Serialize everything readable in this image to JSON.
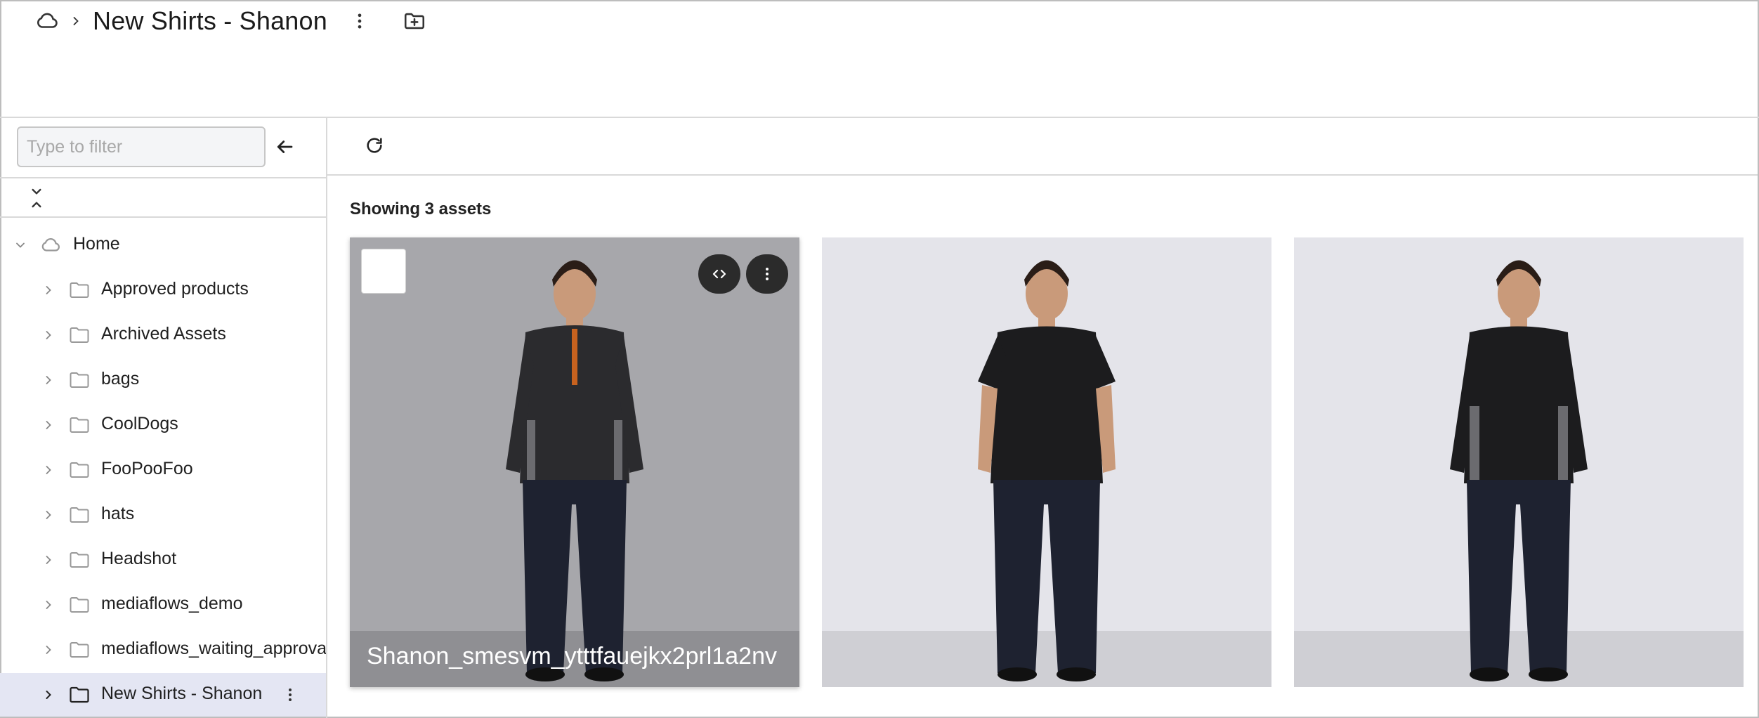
{
  "breadcrumb": {
    "root_icon": "cloud-icon",
    "separator_icon": "chevron-right-icon",
    "title": "New Shirts - Shanon"
  },
  "sidebar": {
    "filter": {
      "placeholder": "Type to filter",
      "value": ""
    },
    "home_label": "Home",
    "items": [
      {
        "label": "Approved products"
      },
      {
        "label": "Archived Assets"
      },
      {
        "label": "bags"
      },
      {
        "label": "CoolDogs"
      },
      {
        "label": "FooPooFoo"
      },
      {
        "label": "hats"
      },
      {
        "label": "Headshot"
      },
      {
        "label": "mediaflows_demo"
      },
      {
        "label": "mediaflows_waiting_approval"
      },
      {
        "label": "New Shirts - Shanon",
        "selected": true
      }
    ]
  },
  "main": {
    "count_text": "Showing 3 assets",
    "assets": [
      {
        "name": "Shanon_smesvm_ytttfauejkx2prl1a2nv",
        "shirt": "half-zip long sleeve top",
        "selected_hover": true
      },
      {
        "name": "",
        "shirt": "short sleeve tee"
      },
      {
        "name": "",
        "shirt": "long sleeve top"
      }
    ]
  },
  "colors": {
    "selected_row": "#e4e6f3",
    "border": "#d9d9d9",
    "card_button": "#2b2b2b"
  }
}
